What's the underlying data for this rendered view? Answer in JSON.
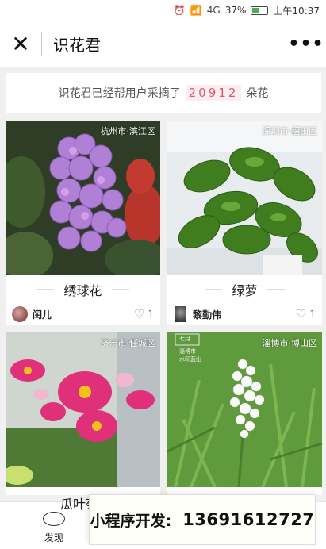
{
  "status_bar": {
    "signal_text": "4G",
    "battery": "37%",
    "time": "上午10:37"
  },
  "nav": {
    "title": "识花君"
  },
  "banner": {
    "prefix": "识花君已经帮用户采摘了",
    "count": "20912",
    "suffix": "朵花"
  },
  "cards": [
    {
      "location": "杭州市·滨江区",
      "name": "绣球花",
      "user": "闰儿",
      "likes": "1"
    },
    {
      "location": "深圳市·福田区",
      "name": "绿萝",
      "user": "黎勤伟",
      "likes": "1"
    },
    {
      "location": "济宁市·任城区",
      "name": "瓜叶菊",
      "user": "",
      "likes": ""
    },
    {
      "location": "淄博市·博山区",
      "name": "",
      "user": "",
      "likes": "",
      "stamp_lines": [
        "七月",
        "淄博市",
        "水印蓝山"
      ]
    }
  ],
  "bottom_tab": {
    "discover_label": "发现"
  },
  "developer_badge": {
    "label": "小程序开发:",
    "phone": "13691612727"
  },
  "colors": {
    "accent_count": "#e0566a",
    "background": "#f0f0f0"
  }
}
